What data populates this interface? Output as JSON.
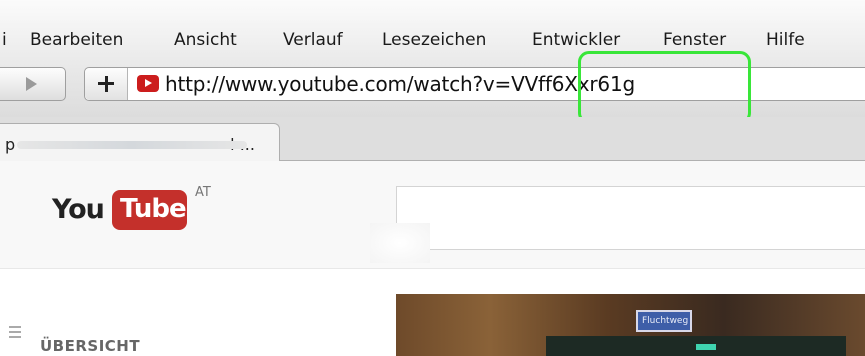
{
  "menu": {
    "items": [
      "i",
      "Bearbeiten",
      "Ansicht",
      "Verlauf",
      "Lesezeichen",
      "Entwickler",
      "Fenster",
      "Hilfe"
    ]
  },
  "toolbar": {
    "url_prefix": "http://www.youtube.com/watch?v",
    "url_highlighted": "=VVff6Xxr61g"
  },
  "tabs": [
    {
      "label_start": "p",
      "label_end": "l ..."
    }
  ],
  "youtube": {
    "logo_you": "You",
    "logo_tube": "Tube",
    "region": "AT",
    "sidebar_heading": "ÜBERSICHT",
    "video_sign": "Fluchtweg"
  },
  "colors": {
    "highlight": "#39e639",
    "youtube_red": "#c4302b"
  }
}
